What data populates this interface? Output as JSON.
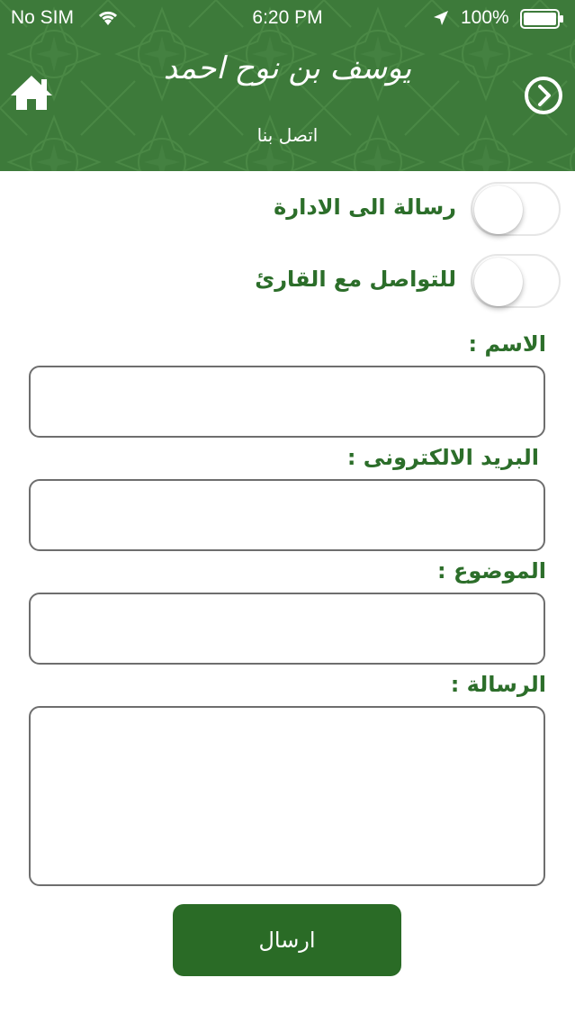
{
  "status_bar": {
    "carrier": "No SIM",
    "time": "6:20 PM",
    "battery": "100%"
  },
  "header": {
    "logo_text": "يوسف بن نوح احمد",
    "page_title": "اتصل بنا",
    "home_icon": "home-icon",
    "forward_icon": "chevron-circle-right-icon"
  },
  "toggles": [
    {
      "label": "رسالة الى الادارة",
      "on": false
    },
    {
      "label": "للتواصل مع القارئ",
      "on": false
    }
  ],
  "form": {
    "name_label": "الاسم :",
    "email_label": "البريد الالكترونى :",
    "subject_label": "الموضوع :",
    "message_label": "الرسالة :",
    "name_value": "",
    "email_value": "",
    "subject_value": "",
    "message_value": ""
  },
  "send_button": "ارسال",
  "colors": {
    "header_green": "#3d7a3a",
    "label_green": "#2c6e2a",
    "button_green": "#2a6b26"
  }
}
